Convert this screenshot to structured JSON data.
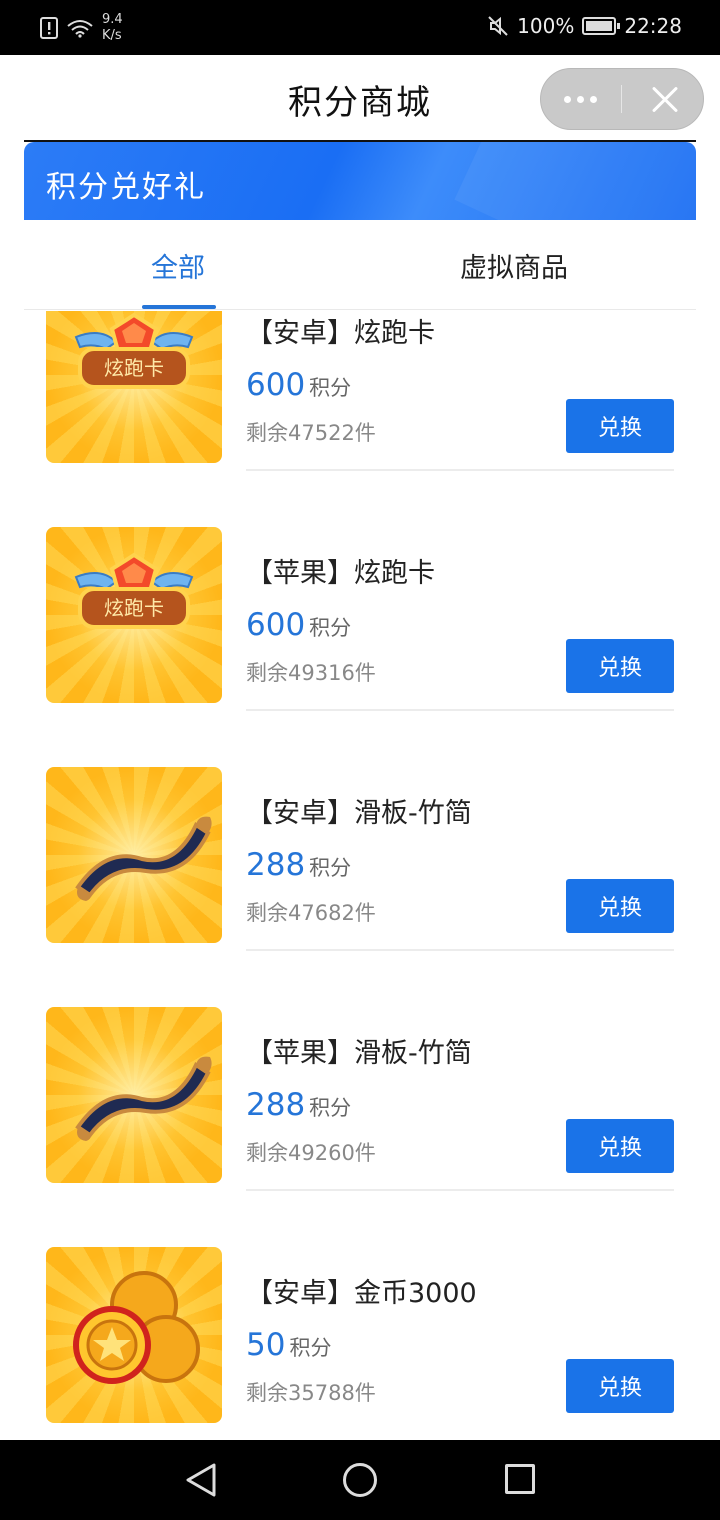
{
  "status_bar": {
    "net_speed_value": "9.4",
    "net_speed_unit": "K/s",
    "battery": "100%",
    "time": "22:28"
  },
  "title_bar": {
    "title": "积分商城"
  },
  "banner": {
    "title": "积分兑好礼"
  },
  "tabs": [
    {
      "label": "全部",
      "active": true
    },
    {
      "label": "虚拟商品",
      "active": false
    }
  ],
  "items": [
    {
      "name": "【安卓】炫跑卡",
      "points": "600",
      "unit": "积分",
      "stock": "剩余47522件",
      "button": "兑换",
      "icon": "run-card-icon",
      "badge_text": "炫跑卡"
    },
    {
      "name": "【苹果】炫跑卡",
      "points": "600",
      "unit": "积分",
      "stock": "剩余49316件",
      "button": "兑换",
      "icon": "run-card-icon",
      "badge_text": "炫跑卡"
    },
    {
      "name": "【安卓】滑板-竹简",
      "points": "288",
      "unit": "积分",
      "stock": "剩余47682件",
      "button": "兑换",
      "icon": "skateboard-scroll-icon"
    },
    {
      "name": "【苹果】滑板-竹简",
      "points": "288",
      "unit": "积分",
      "stock": "剩余49260件",
      "button": "兑换",
      "icon": "skateboard-scroll-icon"
    },
    {
      "name": "【安卓】金币3000",
      "points": "50",
      "unit": "积分",
      "stock": "剩余35788件",
      "button": "兑换",
      "icon": "gold-coins-icon"
    }
  ],
  "colors": {
    "accent": "#1a73e8",
    "price": "#2575d8",
    "banner": "#1a6ef4"
  }
}
